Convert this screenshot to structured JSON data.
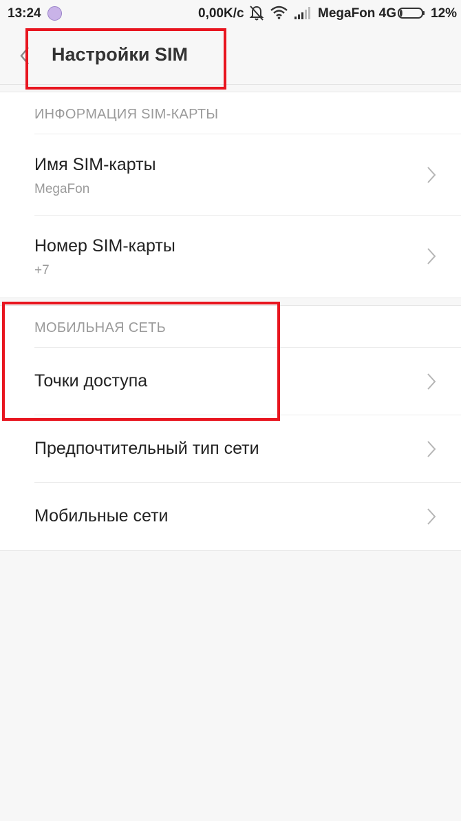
{
  "status_bar": {
    "time": "13:24",
    "speed": "0,00K/c",
    "carrier": "MegaFon 4G",
    "battery_pct": "12%",
    "battery_level": 0.12,
    "icons": [
      "app-notification-icon",
      "bell-muted-icon",
      "wifi-icon",
      "signal-icon",
      "battery-icon"
    ]
  },
  "header": {
    "title": "Настройки SIM",
    "back_icon": "chevron-left-icon"
  },
  "sections": [
    {
      "header": "ИНФОРМАЦИЯ SIM-КАРТЫ",
      "items": [
        {
          "title": "Имя SIM-карты",
          "subtitle": "MegaFon"
        },
        {
          "title": "Номер SIM-карты",
          "subtitle": "+7"
        }
      ]
    },
    {
      "header": "МОБИЛЬНАЯ СЕТЬ",
      "items": [
        {
          "title": "Точки доступа"
        },
        {
          "title": "Предпочтительный тип сети"
        },
        {
          "title": "Мобильные сети"
        }
      ]
    }
  ],
  "colors": {
    "annotation_red": "#e8151f",
    "background": "#f7f7f7",
    "card": "#ffffff",
    "secondary_text": "#9a9a9a"
  }
}
